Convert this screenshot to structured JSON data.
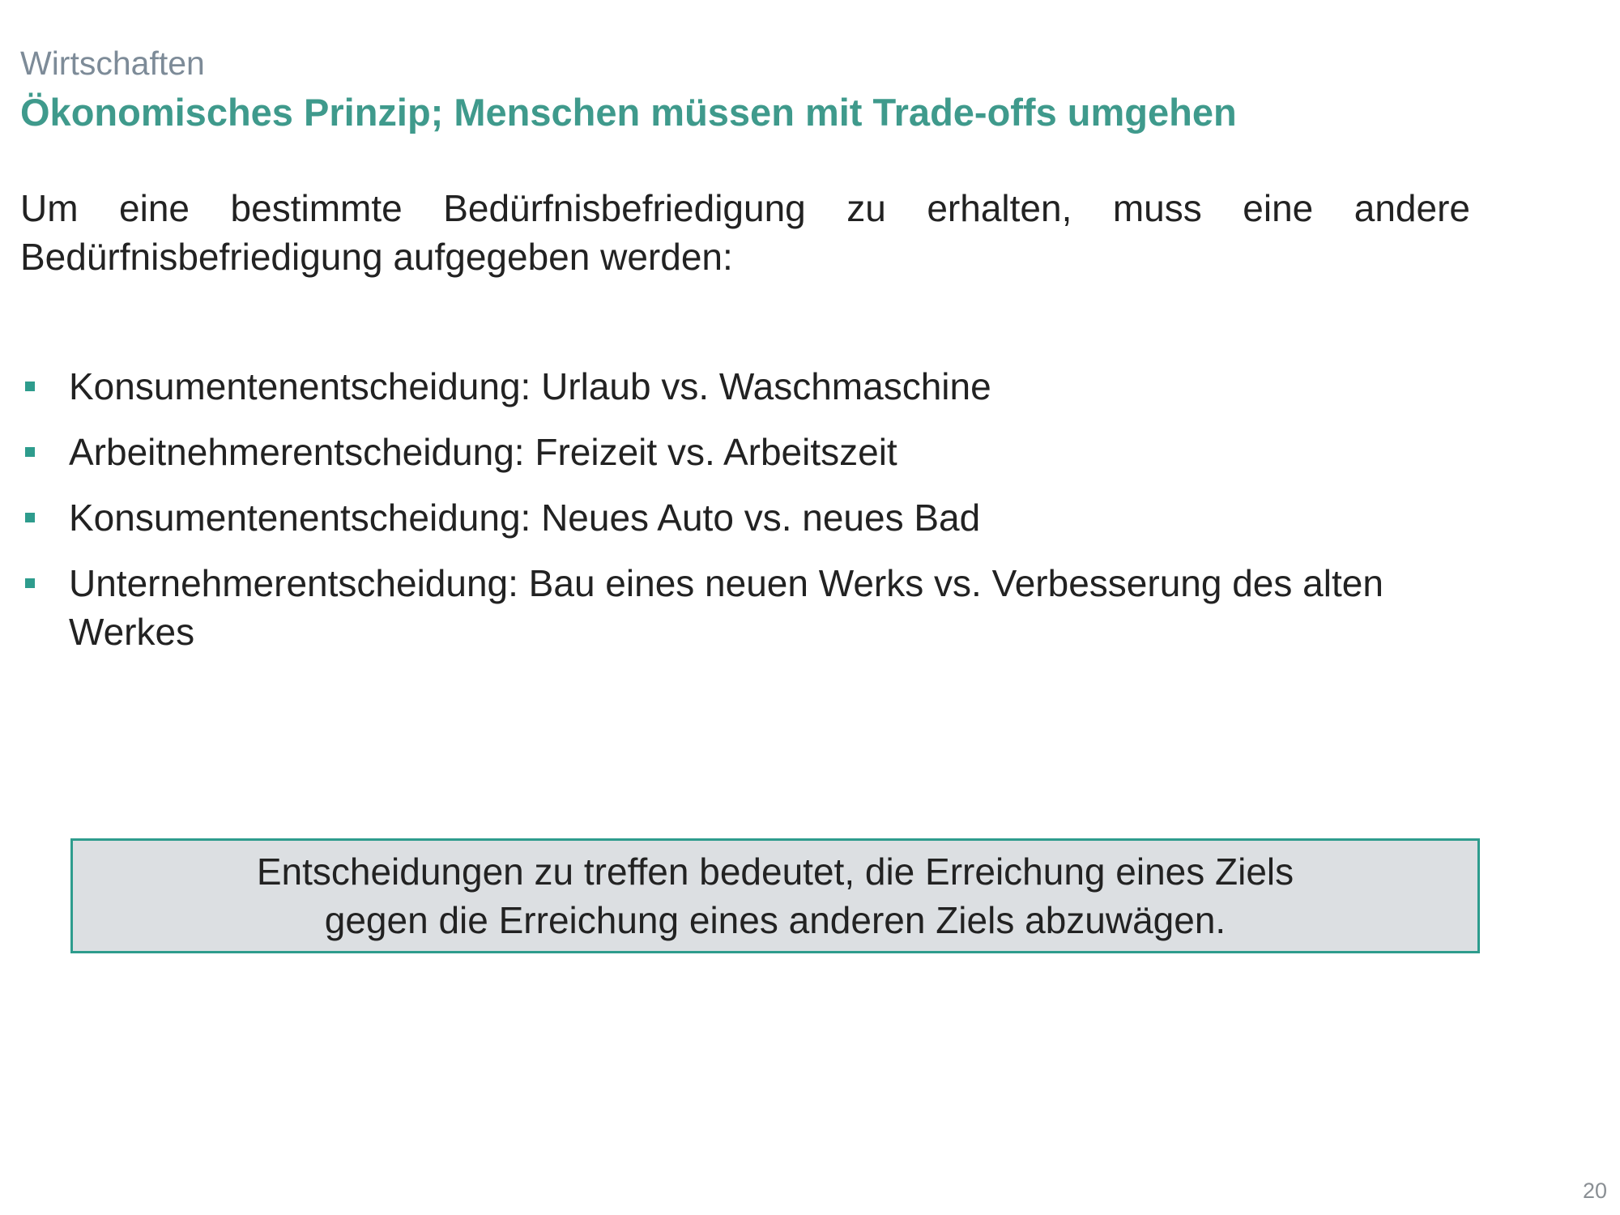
{
  "slide": {
    "kicker": "Wirtschaften",
    "title": "Ökonomisches Prinzip; Menschen müssen mit Trade-offs umgehen",
    "intro": "Um eine bestimmte Bedürfnisbefriedigung zu erhalten, muss eine andere Bedürfnisbefriedigung aufgegeben werden:",
    "bullets": [
      "Konsumentenentscheidung: Urlaub vs. Waschmaschine",
      "Arbeitnehmerentscheidung: Freizeit vs. Arbeitszeit",
      "Konsumentenentscheidung: Neues Auto vs. neues Bad",
      "Unternehmerentscheidung: Bau eines neuen Werks vs. Verbesserung des alten Werkes"
    ],
    "callout": {
      "line1": "Entscheidungen zu treffen bedeutet, die Erreichung eines Ziels",
      "line2": "gegen die Erreichung eines anderen Ziels abzuwägen."
    },
    "page_number": "20"
  },
  "colors": {
    "accent": "#2e9c8d",
    "title": "#3f9a8c",
    "kicker": "#7d8b98",
    "callout_bg": "#dcdfe2",
    "text": "#222222"
  }
}
